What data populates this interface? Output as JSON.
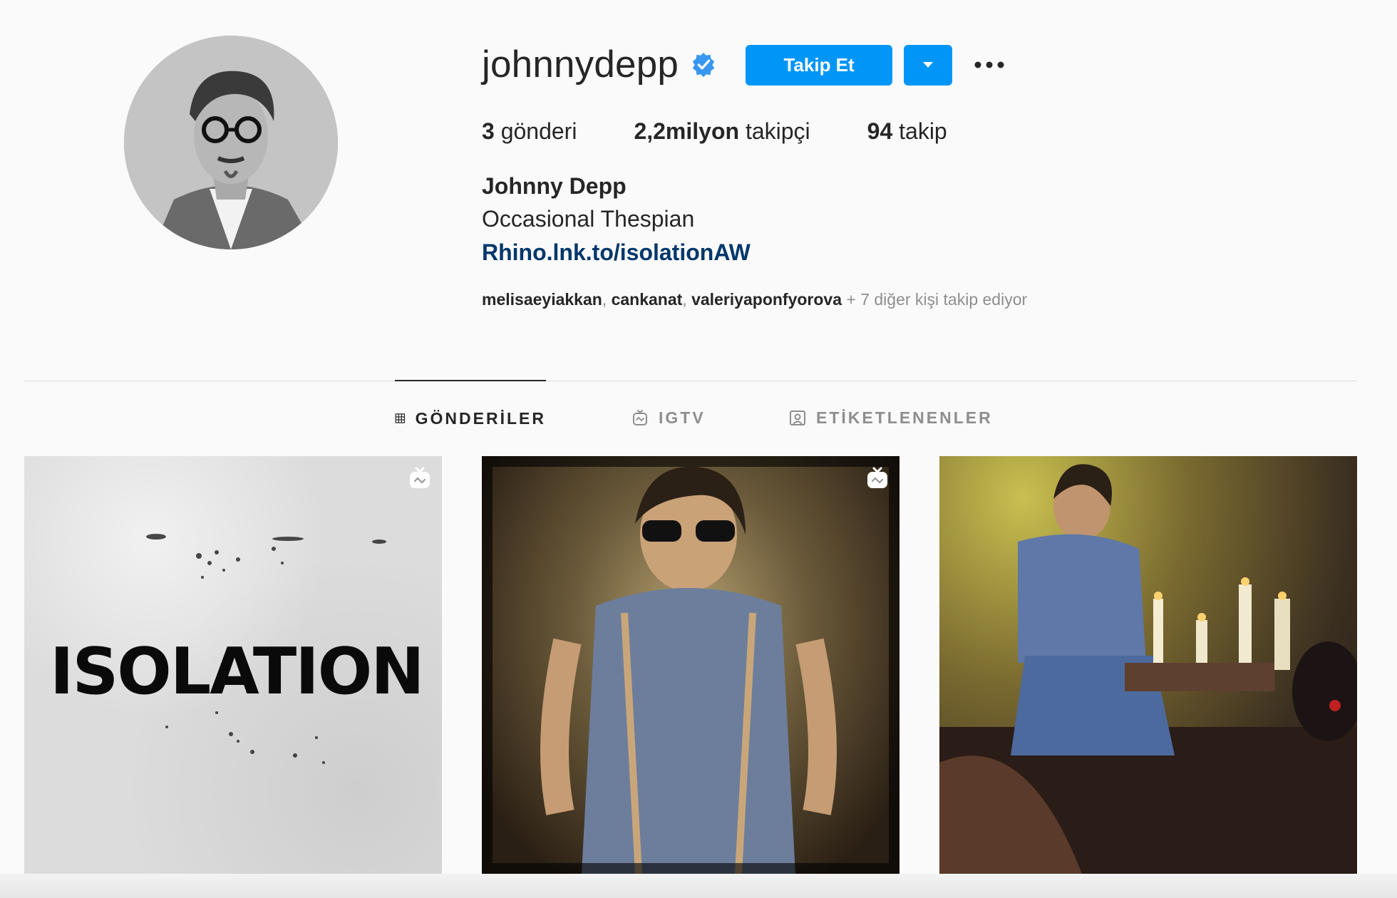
{
  "profile": {
    "username": "johnnydepp",
    "follow_label": "Takip Et",
    "stats": {
      "posts_count": "3",
      "posts_label": " gönderi",
      "followers_count": "2,2milyon",
      "followers_label": " takipçi",
      "following_count": "94",
      "following_label": " takip"
    },
    "full_name": "Johnny Depp",
    "bio": "Occasional Thespian",
    "link": "Rhino.lnk.to/isolationAW",
    "followed_by": {
      "users": [
        "melisaeyiakkan",
        "cankanat",
        "valeriyaponfyorova"
      ],
      "separator": ", ",
      "more": " + 7 diğer kişi takip ediyor"
    }
  },
  "tabs": [
    {
      "label": "GÖNDERİLER",
      "icon": "grid-icon",
      "active": true
    },
    {
      "label": "IGTV",
      "icon": "igtv-icon",
      "active": false
    },
    {
      "label": "ETİKETLENENLER",
      "icon": "tagged-icon",
      "active": false
    }
  ],
  "posts": [
    {
      "text": "ISOLATION",
      "igtv": true
    },
    {
      "text": "",
      "igtv": true
    },
    {
      "text": "",
      "igtv": false
    }
  ],
  "colors": {
    "accent": "#0095f6",
    "link": "#00376b",
    "verified": "#3897f0",
    "muted": "#8e8e8e"
  }
}
